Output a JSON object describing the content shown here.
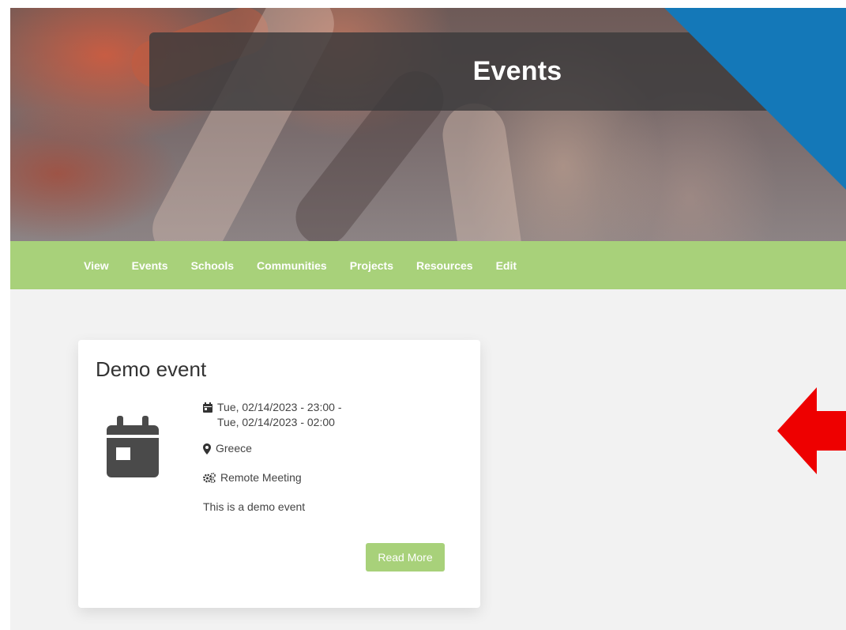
{
  "hero": {
    "title": "Events"
  },
  "nav": {
    "items": [
      {
        "label": "View"
      },
      {
        "label": "Events"
      },
      {
        "label": "Schools"
      },
      {
        "label": "Communities"
      },
      {
        "label": "Projects"
      },
      {
        "label": "Resources"
      },
      {
        "label": "Edit"
      }
    ]
  },
  "event_card": {
    "title": "Demo event",
    "date_start": "Tue, 02/14/2023 - 23:00 -",
    "date_end": "Tue, 02/14/2023 - 02:00",
    "location": "Greece",
    "type": "Remote Meeting",
    "description": "This is a demo event",
    "read_more_label": "Read More",
    "big_icon": "calendar-icon"
  },
  "colors": {
    "nav_bg": "#a8d17a",
    "button_bg": "#a8d17a",
    "corner_accent": "#1478b8",
    "arrow": "#ee0000",
    "page_bg": "#f2f2f2"
  }
}
